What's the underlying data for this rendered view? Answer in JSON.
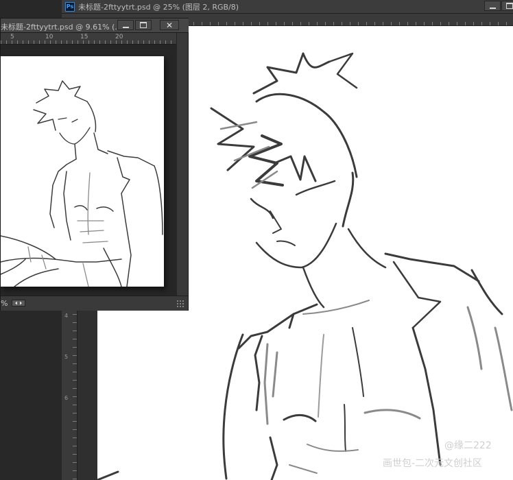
{
  "main_window": {
    "app_icon_label": "Ps",
    "title": "未标题-2fttyytrt.psd @ 25% (图层 2, RGB/8)",
    "vertical_ruler_labels": [
      "4",
      "5",
      "6"
    ]
  },
  "floating_window": {
    "title": "未标题-2fttyytrt.psd @ 9.61% (...",
    "close_label": "✕",
    "ruler_labels": [
      "5",
      "10",
      "15",
      "20"
    ],
    "zoom_readout": "%"
  },
  "watermark": {
    "handle": "@缘二222",
    "site": "画世包-二次元文创社区"
  },
  "colors": {
    "ps_blue": "#39a0ff",
    "ui_dark": "#282828",
    "canvas": "#ffffff",
    "ink": "#3b3b3b"
  },
  "icons": [
    "photoshop-app-icon",
    "minimize-icon",
    "maximize-icon",
    "close-icon",
    "status-arrow-icon",
    "resize-grip-icon"
  ]
}
